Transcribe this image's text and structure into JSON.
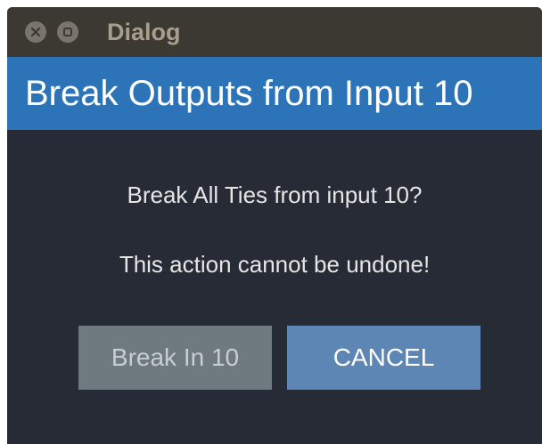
{
  "titlebar": {
    "title": "Dialog",
    "close_icon": "close-icon",
    "maximize_icon": "maximize-icon"
  },
  "header": {
    "title": "Break Outputs from Input 10"
  },
  "message": {
    "line1": "Break All Ties from input 10?",
    "line2": "This action cannot be undone!"
  },
  "buttons": {
    "break_label": "Break In 10",
    "cancel_label": "CANCEL"
  },
  "colors": {
    "titlebar": "#3c3832",
    "header": "#2d73b8",
    "body": "#262b35",
    "break_button": "#6e7a80",
    "cancel_button": "#5d86b5"
  }
}
